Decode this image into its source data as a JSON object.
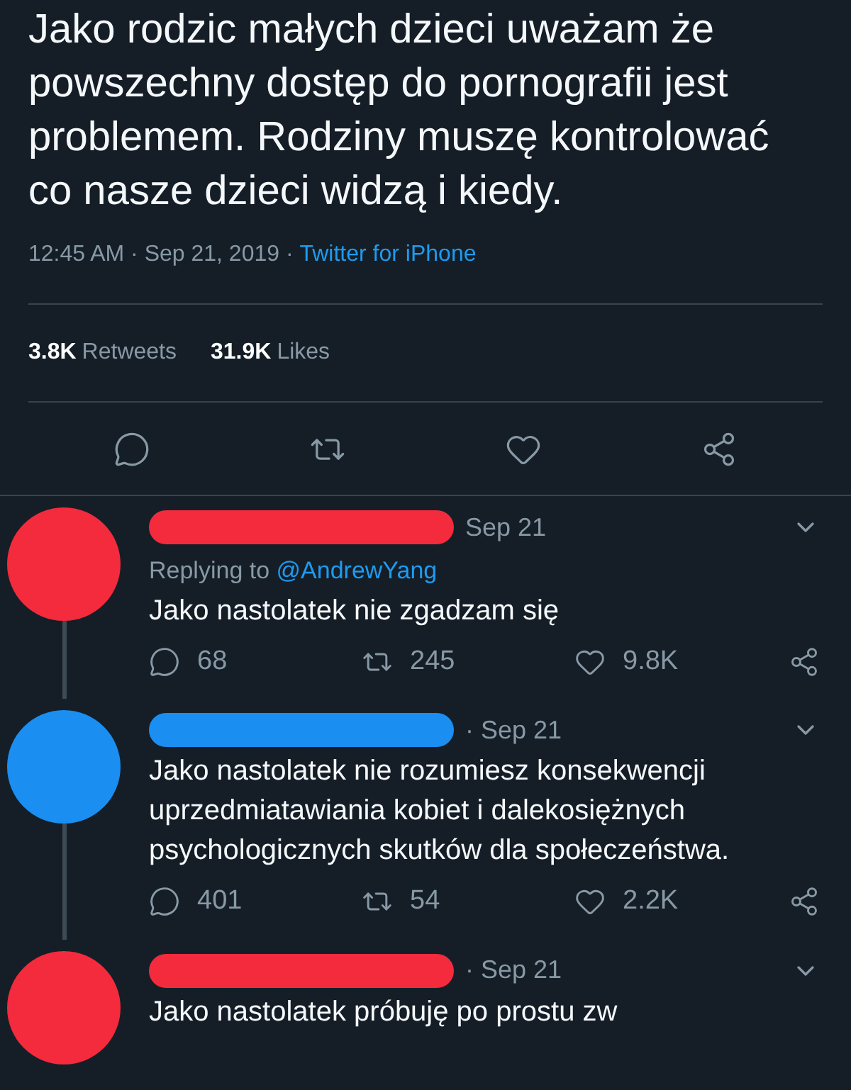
{
  "tweet": {
    "text": "Jako rodzic małych dzieci uważam że powszechny dostęp do pornografii jest problemem. Rodziny muszę kontrolować co nasze dzieci widzą i kiedy.",
    "time": "12:45 AM · Sep 21, 2019 · ",
    "source": "Twitter for iPhone",
    "stats": [
      {
        "count": "3.8K",
        "label": "Retweets"
      },
      {
        "count": "31.9K",
        "label": "Likes"
      }
    ]
  },
  "replies": [
    {
      "color": "#f32b3d",
      "date": "Sep 21",
      "replying_label": "Replying to ",
      "replying_to": "@AndrewYang",
      "text": "Jako nastolatek nie zgadzam się",
      "replies": "68",
      "retweets": "245",
      "likes": "9.8K"
    },
    {
      "color": "#1b8ef2",
      "date": "· Sep 21",
      "text": "Jako nastolatek nie rozumiesz konsekwencji uprzedmiatawiania kobiet i dalekosiężnych psychologicznych skutków dla społeczeństwa.",
      "replies": "401",
      "retweets": "54",
      "likes": "2.2K"
    },
    {
      "color": "#f32b3d",
      "date": "· Sep 21",
      "text": "Jako nastolatek próbuję po prostu zw"
    }
  ]
}
